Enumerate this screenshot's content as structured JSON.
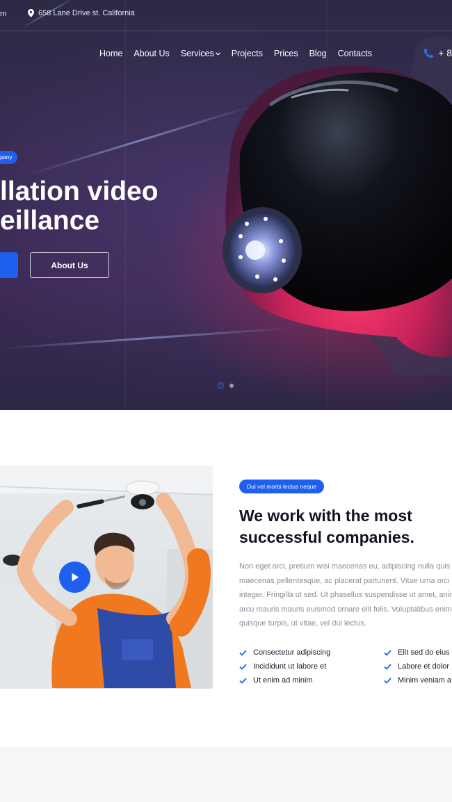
{
  "topbar": {
    "left_fragment": "m",
    "address": "658 Lane Drive st. California",
    "address_icon": "map-pin-icon"
  },
  "nav": {
    "items": [
      {
        "label": "Home"
      },
      {
        "label": "About Us"
      },
      {
        "label": "Services"
      },
      {
        "label": "Projects"
      },
      {
        "label": "Prices"
      },
      {
        "label": "Blog"
      },
      {
        "label": "Contacts"
      }
    ],
    "phone_fragment": "+ 8",
    "phone_icon": "phone-icon"
  },
  "hero": {
    "badge": "pany",
    "title_line1": "llation video",
    "title_line2": "eillance",
    "outline_button": "About Us",
    "slide_count": 2,
    "active_slide": 1
  },
  "about": {
    "badge": "Dui vel morbi lectus neque",
    "title_line1": "We work with the most",
    "title_line2": "successful companies.",
    "paragraph_lines": [
      "Non eget orci, pretium wisi maecenas eu, adipiscing nulla quis",
      "maecenas pellentesque, ac placerat parturient. Vitae urna orci",
      "integer. Fringilla ut sed. Ut phasellus suspendisse ut amet, anim",
      "arcu mauris mauris euismod ornare elit felis. Voluptatibus enim",
      "quisque turpis, ut vitae, vel dui lectus."
    ],
    "checks_left": [
      "Consectetur adipiscing",
      "Incididunt ut labore et",
      "Ut enim ad minim"
    ],
    "checks_right": [
      "Elit sed do eius",
      "Labore et dolor",
      "Minim veniam a"
    ],
    "check_icon": "checkmark-icon",
    "play_icon": "play-icon"
  },
  "colors": {
    "accent": "#1f5ff0",
    "heading": "#101322",
    "body_text": "#8a8d99"
  }
}
